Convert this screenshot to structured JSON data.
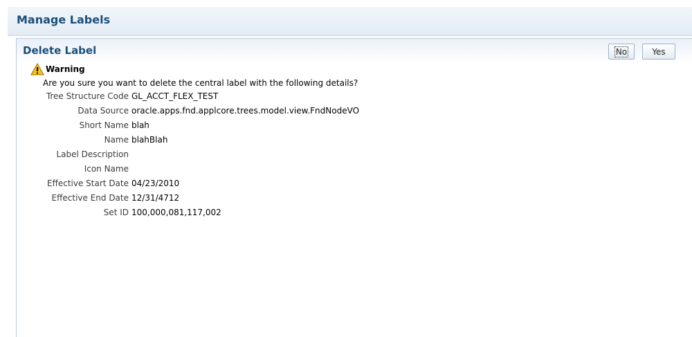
{
  "page": {
    "title": "Manage Labels"
  },
  "dialog": {
    "title": "Delete Label",
    "buttons": {
      "no": "No",
      "yes": "Yes"
    },
    "warning_title": "Warning",
    "message": "Are you sure you want to delete the central label with the following details?",
    "details": [
      {
        "label": "Tree Structure Code",
        "value": "GL_ACCT_FLEX_TEST"
      },
      {
        "label": "Data Source",
        "value": "oracle.apps.fnd.applcore.trees.model.view.FndNodeVO"
      },
      {
        "label": "Short Name",
        "value": "blah"
      },
      {
        "label": "Name",
        "value": "blahBlah"
      },
      {
        "label": "Label Description",
        "value": ""
      },
      {
        "label": "Icon Name",
        "value": ""
      },
      {
        "label": "Effective Start Date",
        "value": "04/23/2010"
      },
      {
        "label": "Effective End Date",
        "value": "12/31/4712"
      },
      {
        "label": "Set ID",
        "value": "100,000,081,117,002"
      }
    ]
  },
  "icons": {
    "warning": "warning-triangle-icon"
  },
  "colors": {
    "title": "#1a4f7a",
    "warning_fill": "#f7c21b"
  }
}
